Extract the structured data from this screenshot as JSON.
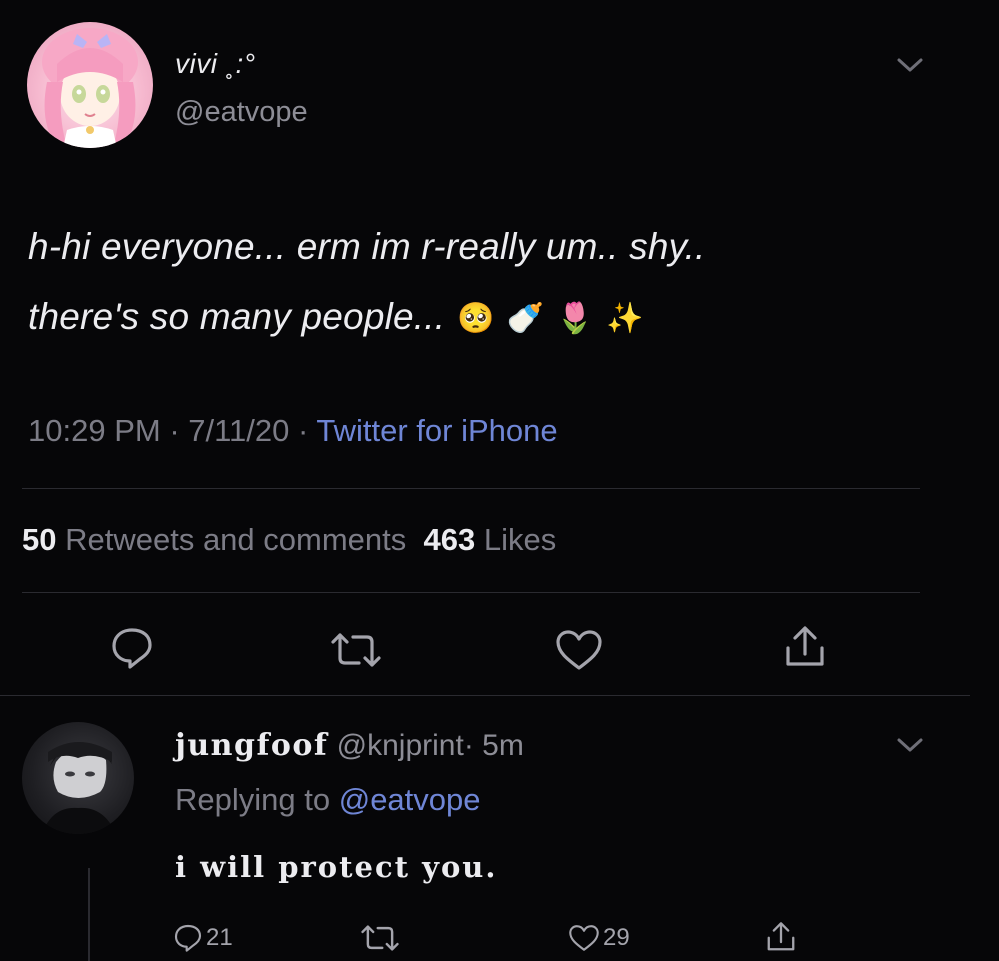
{
  "tweet": {
    "display_name": "vivi ˳:°",
    "handle": "@eatvope",
    "text_line1": "h-hi everyone... erm im r-really um.. shy..",
    "text_line2": "there's so many people...",
    "emojis": [
      "🥺",
      "🍼",
      "🌷",
      "✨"
    ],
    "time": "10:29 PM",
    "date": "7/11/20",
    "separator": " · ",
    "source": "Twitter for iPhone",
    "retweets_count": "50",
    "retweets_label": "Retweets and comments",
    "likes_count": "463",
    "likes_label": "Likes"
  },
  "reply": {
    "display_name": "jungfoof",
    "handle": "@knjprint",
    "time_ago": "· 5m",
    "replying_prefix": "Replying to",
    "replying_to": "@eatvope",
    "text": "i will protect you.",
    "comment_count": "21",
    "like_count": "29"
  },
  "icons": [
    "avatar",
    "chevron-down-icon",
    "comment-icon",
    "retweet-icon",
    "heart-icon",
    "share-icon"
  ],
  "colors": {
    "background": "#060608",
    "text": "#ececf0",
    "muted": "#7c7c86",
    "link": "#6f86d6"
  }
}
